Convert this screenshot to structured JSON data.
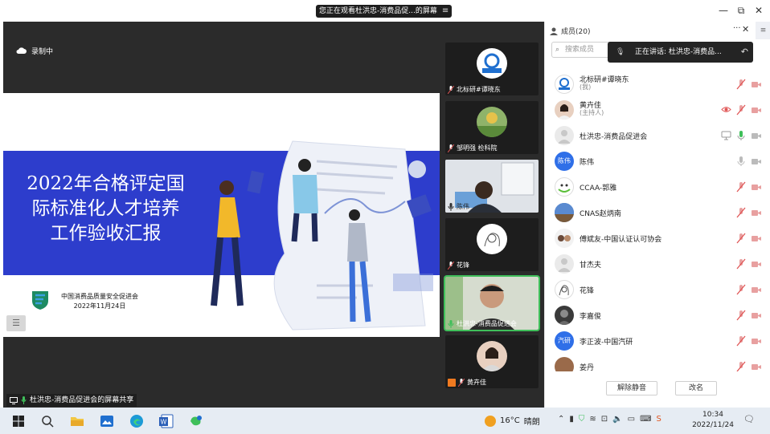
{
  "share_banner": {
    "text": "您正在观看杜洪忠-消费品促...的屏幕",
    "menu_icon": "≡"
  },
  "window_controls": {
    "minimize": "—",
    "restore": "⧉",
    "close": "✕"
  },
  "stage": {
    "recording_label": "录制中",
    "slide": {
      "title_lines": [
        "2022年合格评定国",
        "际标准化人才培养",
        "工作验收汇报"
      ],
      "org": "中国消费品质量安全促进会",
      "date": "2022年11月24日"
    },
    "sidebar_toggle": "☰",
    "screen_share_caption": "杜洪忠-消费品促进会的屏幕共享"
  },
  "video_tiles": [
    {
      "name": "北标研#谭晓东"
    },
    {
      "name": "邹明强 检科院"
    },
    {
      "name": "陈伟"
    },
    {
      "name": "花锋"
    },
    {
      "name": "杜洪忠-消费品促进会"
    },
    {
      "name": "黄卉佳"
    }
  ],
  "member_panel": {
    "title": "成员(20)",
    "more": "···",
    "close": "✕",
    "menu": "≡",
    "search_placeholder": "搜索成员",
    "speaking_banner": "正在讲话: 杜洪忠-消费品...",
    "members": [
      {
        "name": "北标研#谭晓东",
        "sub": "(我)",
        "avatar": "qsadi-logo",
        "mic": "muted",
        "cam": "off"
      },
      {
        "name": "黄卉佳",
        "sub": "(主持人)",
        "avatar": "photo",
        "mic": "muted",
        "cam": "off",
        "extra": "eye-icon"
      },
      {
        "name": "杜洪忠-消费品促进会",
        "sub": "",
        "avatar": "default",
        "mic": "on",
        "cam": "off",
        "extra": "screen-share-icon"
      },
      {
        "name": "陈伟",
        "sub": "",
        "avatar": "text",
        "avatar_text": "陈伟",
        "avatar_color": "#2f6fe8",
        "mic": "idle",
        "cam": "off"
      },
      {
        "name": "CCAA-郭雅",
        "sub": "",
        "avatar": "photo",
        "mic": "muted",
        "cam": "off"
      },
      {
        "name": "CNAS赵炳南",
        "sub": "",
        "avatar": "photo",
        "mic": "muted",
        "cam": "off"
      },
      {
        "name": "傅斌友-中国认证认可协会",
        "sub": "",
        "avatar": "photo",
        "mic": "muted",
        "cam": "off"
      },
      {
        "name": "甘杰夫",
        "sub": "",
        "avatar": "default",
        "mic": "muted",
        "cam": "off"
      },
      {
        "name": "花锋",
        "sub": "",
        "avatar": "sketch",
        "mic": "muted",
        "cam": "off"
      },
      {
        "name": "李嘉俊",
        "sub": "",
        "avatar": "photo",
        "mic": "muted",
        "cam": "off"
      },
      {
        "name": "李正波-中国汽研",
        "sub": "",
        "avatar": "text",
        "avatar_text": "汽研",
        "avatar_color": "#2f6fe8",
        "mic": "muted",
        "cam": "off"
      },
      {
        "name": "姜丹",
        "sub": "",
        "avatar": "photo",
        "mic": "muted",
        "cam": "off"
      }
    ],
    "buttons": {
      "unmute_all": "解除静音",
      "rename": "改名"
    }
  },
  "taskbar": {
    "weather": {
      "temp": "16°C",
      "desc": "晴朗"
    },
    "time": "10:34",
    "date": "2022/11/24"
  },
  "colors": {
    "slide_blue": "#2d3dcc",
    "muted_red": "#e05555",
    "active_green": "#3fbf5a",
    "taskbar": "#e6ecf3"
  }
}
